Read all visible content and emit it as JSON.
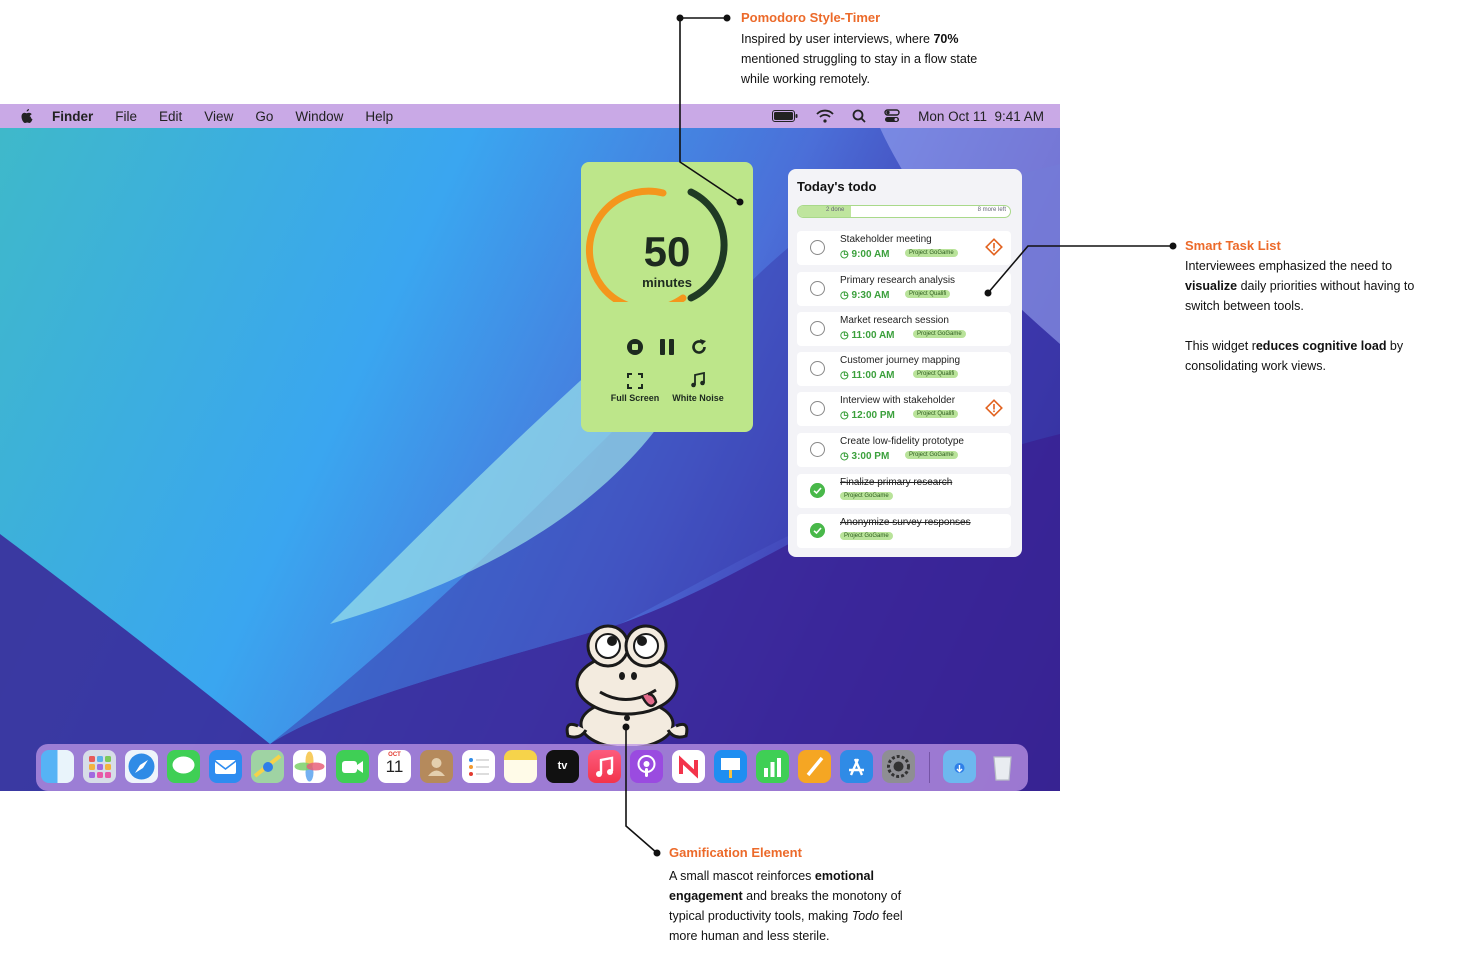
{
  "menubar": {
    "app_name": "Finder",
    "menus": [
      "File",
      "Edit",
      "View",
      "Go",
      "Window",
      "Help"
    ],
    "date": "Mon Oct 11",
    "time": "9:41 AM"
  },
  "timer": {
    "minutes_value": "50",
    "minutes_label": "minutes",
    "fullscreen_label": "Full Screen",
    "white_noise_label": "White Noise"
  },
  "todo": {
    "title": "Today's todo",
    "done_label": "2 done",
    "left_label": "8 more left",
    "tasks": [
      {
        "name": "Stakeholder meeting",
        "time": "9:00 AM",
        "tag": "Project GoGame",
        "completed": false,
        "priority": true
      },
      {
        "name": "Primary research analysis",
        "time": "9:30 AM",
        "tag": "Project Qualifi",
        "completed": false,
        "priority": false
      },
      {
        "name": "Market research session",
        "time": "11:00 AM",
        "tag": "Project GoGame",
        "completed": false,
        "priority": false
      },
      {
        "name": "Customer journey mapping",
        "time": "11:00 AM",
        "tag": "Project Qualifi",
        "completed": false,
        "priority": false
      },
      {
        "name": "Interview with stakeholder",
        "time": "12:00 PM",
        "tag": "Project Qualifi",
        "completed": false,
        "priority": true
      },
      {
        "name": "Create low-fidelity prototype",
        "time": "3:00 PM",
        "tag": "Project GoGame",
        "completed": false,
        "priority": false
      },
      {
        "name": "Finalize primary research",
        "time": "",
        "tag": "Project GoGame",
        "completed": true,
        "priority": false
      },
      {
        "name": "Anonymize survey responses",
        "time": "",
        "tag": "Project GoGame",
        "completed": true,
        "priority": false
      }
    ]
  },
  "dock": {
    "calendar_month": "OCT",
    "calendar_day": "11",
    "tv_label": "tv"
  },
  "annotations": {
    "pomodoro": {
      "title": "Pomodoro Style-Timer",
      "l1a": "Inspired by user interviews, where ",
      "l1b": "70%",
      "l2": "mentioned struggling to stay in a flow state",
      "l3": "while working remotely."
    },
    "tasks": {
      "title": "Smart Task List",
      "l1": "Interviewees emphasized the need to",
      "l2a": "visualize",
      "l2b": " daily priorities without having to",
      "l3": "switch between tools.",
      "l4a": "This widget r",
      "l4b": "educes cognitive load",
      "l4c": " by",
      "l5": "consolidating work views."
    },
    "gamification": {
      "title": "Gamification Element",
      "l1a": "A small mascot reinforces ",
      "l1b": "emotional",
      "l2a": "engagement",
      "l2b": " and breaks the monotony of",
      "l3a": "typical productivity tools, making ",
      "l3b": "Todo",
      "l3c": " feel",
      "l4": "more human and less sterile."
    }
  },
  "colors": {
    "accent_orange": "#ec6a2a",
    "timer_green": "#bde68a",
    "task_green": "#3ba03c",
    "menubar": "#c9a9e6"
  }
}
